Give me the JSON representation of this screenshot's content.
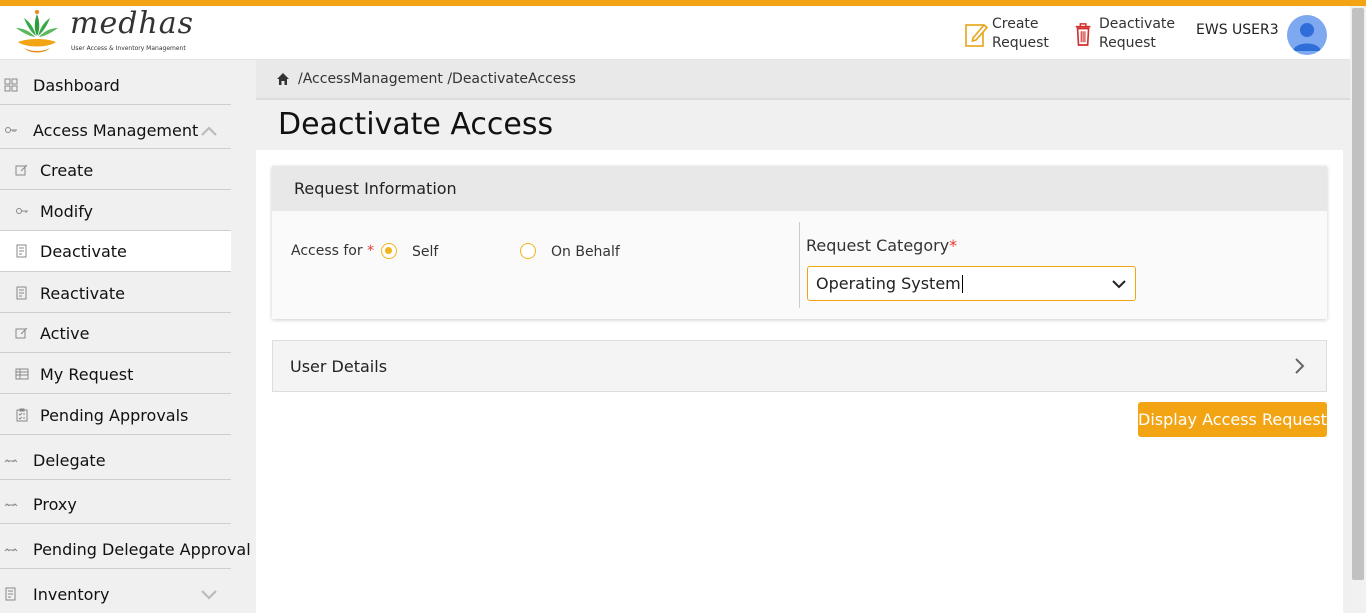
{
  "brand": {
    "logo_text": "medhas",
    "tagline": "User Access & Inventory Management"
  },
  "header": {
    "create_request": [
      "Create",
      "Request"
    ],
    "deactivate_request": [
      "Deactivate",
      "Request"
    ],
    "user_name": "EWS USER3"
  },
  "sidebar": {
    "dashboard": "Dashboard",
    "access_management": "Access Management",
    "create": "Create",
    "modify": "Modify",
    "deactivate": "Deactivate",
    "reactivate": "Reactivate",
    "active": "Active",
    "my_request": "My Request",
    "pending_approvals": "Pending Approvals",
    "delegate": "Delegate",
    "proxy": "Proxy",
    "pending_delegate_approval": "Pending Delegate Approval",
    "inventory": "Inventory"
  },
  "breadcrumb": "/AccessManagement /DeactivateAccess",
  "page_title": "Deactivate Access",
  "request_info": {
    "heading": "Request Information",
    "access_for_label": "Access for",
    "required_mark": "*",
    "option_self": "Self",
    "option_on_behalf": "On Behalf",
    "selected": "Self",
    "category_label": "Request Category",
    "category_value": "Operating System"
  },
  "user_details": {
    "heading": "User Details"
  },
  "actions": {
    "display_label": "Display Access Request"
  },
  "colors": {
    "accent": "#f2a413",
    "required": "#e53935"
  }
}
